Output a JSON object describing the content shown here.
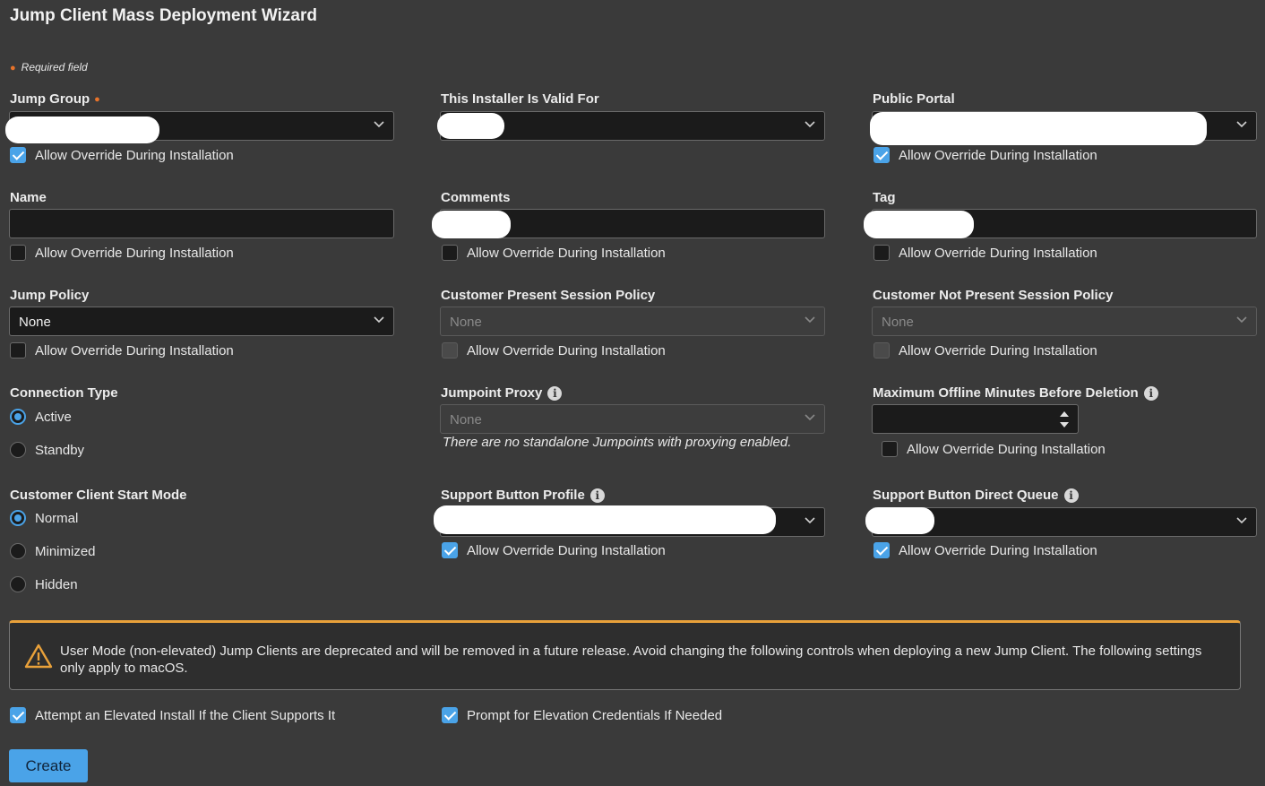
{
  "title": "Jump Client Mass Deployment Wizard",
  "required_note": "Required field",
  "override_label": "Allow Override During Installation",
  "fields": {
    "jump_group": {
      "label": "Jump Group",
      "override_checked": true
    },
    "installer_valid_for": {
      "label": "This Installer Is Valid For"
    },
    "public_portal": {
      "label": "Public Portal",
      "override_checked": true
    },
    "name": {
      "label": "Name",
      "value": "",
      "override_checked": false
    },
    "comments": {
      "label": "Comments",
      "override_checked": false
    },
    "tag": {
      "label": "Tag",
      "override_checked": false
    },
    "jump_policy": {
      "label": "Jump Policy",
      "value": "None",
      "override_checked": false
    },
    "customer_present_policy": {
      "label": "Customer Present Session Policy",
      "value": "None",
      "disabled": true,
      "override_checked": false
    },
    "customer_not_present_policy": {
      "label": "Customer Not Present Session Policy",
      "value": "None",
      "disabled": true,
      "override_checked": false
    },
    "connection_type": {
      "label": "Connection Type",
      "options": [
        "Active",
        "Standby"
      ],
      "selected": "Active"
    },
    "jumpoint_proxy": {
      "label": "Jumpoint Proxy",
      "value": "None",
      "disabled": true,
      "hint": "There are no standalone Jumpoints with proxying enabled.",
      "icon": "info-icon"
    },
    "max_offline_minutes": {
      "label": "Maximum Offline Minutes Before Deletion",
      "value": "",
      "override_checked": false,
      "icon": "info-icon"
    },
    "client_start_mode": {
      "label": "Customer Client Start Mode",
      "options": [
        "Normal",
        "Minimized",
        "Hidden"
      ],
      "selected": "Normal"
    },
    "support_button_profile": {
      "label": "Support Button Profile",
      "override_checked": true,
      "icon": "info-icon"
    },
    "support_button_queue": {
      "label": "Support Button Direct Queue",
      "override_checked": true,
      "icon": "info-icon"
    }
  },
  "warning": {
    "icon": "warning-triangle-icon",
    "text": "User Mode (non-elevated) Jump Clients are deprecated and will be removed in a future release. Avoid changing the following controls when deploying a new Jump Client. The following settings only apply to macOS."
  },
  "elevated_install": {
    "label": "Attempt an Elevated Install If the Client Supports It",
    "checked": true
  },
  "prompt_elevation": {
    "label": "Prompt for Elevation Credentials If Needed",
    "checked": true
  },
  "create_button": "Create",
  "colors": {
    "accent": "#4aa3e8",
    "warning_border": "#e9a13a",
    "required_dot": "#e8732a",
    "background": "#3a3a3a"
  }
}
